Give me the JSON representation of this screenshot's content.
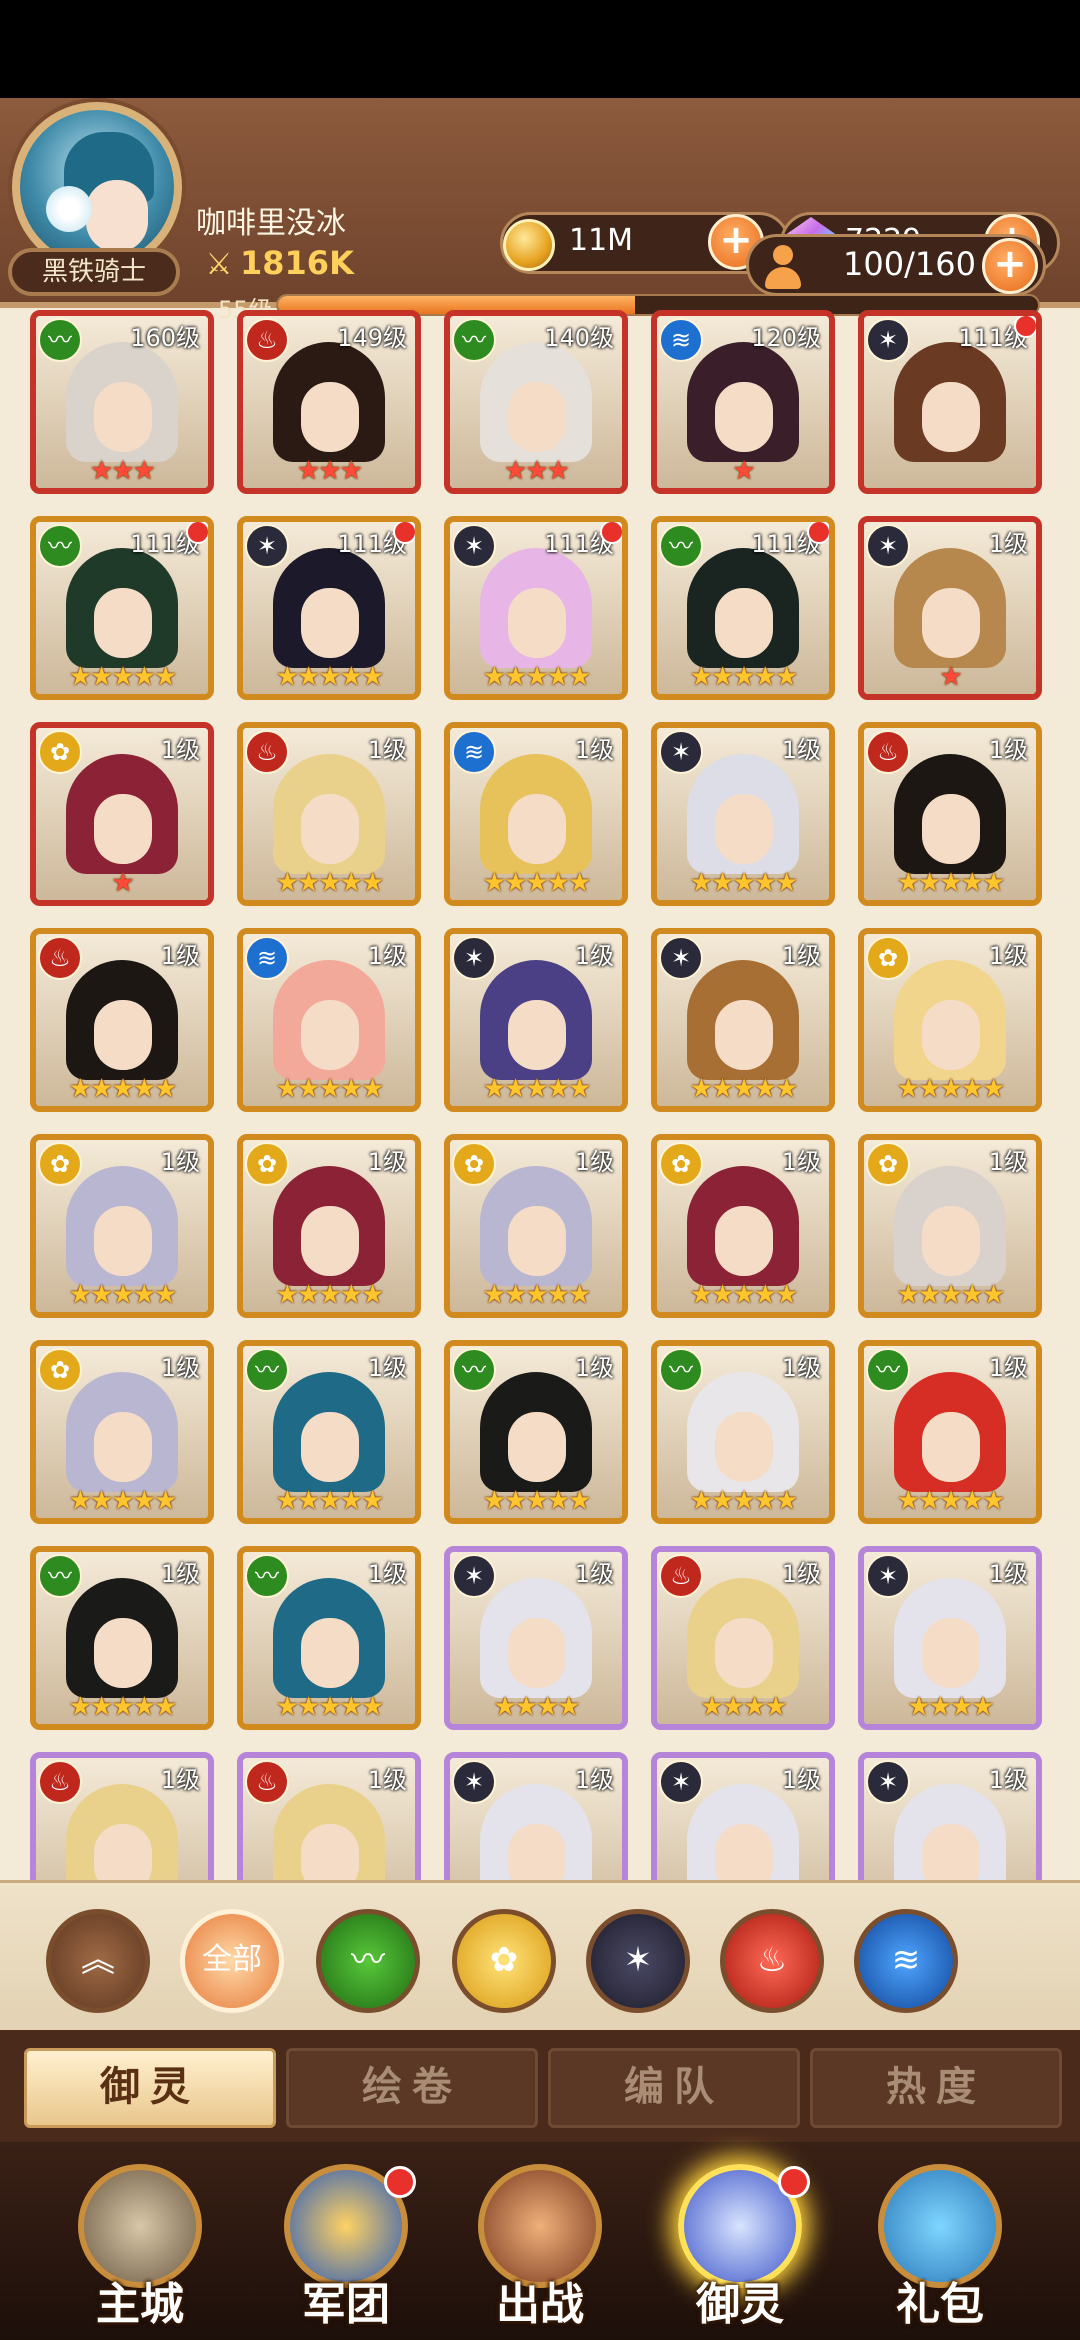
{
  "header": {
    "player_name": "咖啡里没冰",
    "power": "1816K",
    "level": "55级",
    "xp_fraction": 0.47,
    "rank_title": "黑铁骑士",
    "gold": "11M",
    "gems": "7229",
    "roster_capacity": "100/160"
  },
  "colors": {
    "nature": "#2e8b1f",
    "flame": "#c0281e",
    "water": "#1d6fd0",
    "shadow": "#2b2a3a",
    "light": "#e3a91a"
  },
  "cards": [
    {
      "level": "160级",
      "faction": "nature",
      "stars": "★★★",
      "star_color": "red",
      "frame": "red",
      "notif": false,
      "hair": "#d9d3cc"
    },
    {
      "level": "149级",
      "faction": "flame",
      "stars": "★★★",
      "star_color": "red",
      "frame": "red",
      "notif": false,
      "hair": "#2b1a14"
    },
    {
      "level": "140级",
      "faction": "nature",
      "stars": "★★★",
      "star_color": "red",
      "frame": "red",
      "notif": false,
      "hair": "#e6e0da"
    },
    {
      "level": "120级",
      "faction": "water",
      "stars": "★",
      "star_color": "red",
      "frame": "red",
      "notif": false,
      "hair": "#3a1f2a"
    },
    {
      "level": "111级",
      "faction": "shadow",
      "stars": "",
      "star_color": "red",
      "frame": "red",
      "notif": true,
      "hair": "#6a3a22"
    },
    {
      "level": "111级",
      "faction": "nature",
      "stars": "★★★★★",
      "star_color": "gold",
      "frame": "gold",
      "notif": true,
      "hair": "#203a2a"
    },
    {
      "level": "111级",
      "faction": "shadow",
      "stars": "★★★★★",
      "star_color": "gold",
      "frame": "gold",
      "notif": true,
      "hair": "#1c1a2a"
    },
    {
      "level": "111级",
      "faction": "shadow",
      "stars": "★★★★★",
      "star_color": "gold",
      "frame": "gold",
      "notif": true,
      "hair": "#e7b6e6"
    },
    {
      "level": "111级",
      "faction": "nature",
      "stars": "★★★★★",
      "star_color": "gold",
      "frame": "gold",
      "notif": true,
      "hair": "#1a2420"
    },
    {
      "level": "1级",
      "faction": "shadow",
      "stars": "★",
      "star_color": "red",
      "frame": "red",
      "notif": false,
      "hair": "#b7884d"
    },
    {
      "level": "1级",
      "faction": "light",
      "stars": "★",
      "star_color": "red",
      "frame": "red",
      "notif": false,
      "hair": "#8c2236"
    },
    {
      "level": "1级",
      "faction": "flame",
      "stars": "★★★★★",
      "star_color": "gold",
      "frame": "gold",
      "notif": false,
      "hair": "#e9d18c"
    },
    {
      "level": "1级",
      "faction": "water",
      "stars": "★★★★★",
      "star_color": "gold",
      "frame": "gold",
      "notif": false,
      "hair": "#e7c15a"
    },
    {
      "level": "1级",
      "faction": "shadow",
      "stars": "★★★★★",
      "star_color": "gold",
      "frame": "gold",
      "notif": false,
      "hair": "#dcdde6"
    },
    {
      "level": "1级",
      "faction": "flame",
      "stars": "★★★★★",
      "star_color": "gold",
      "frame": "gold",
      "notif": false,
      "hair": "#1d1714"
    },
    {
      "level": "1级",
      "faction": "flame",
      "stars": "★★★★★",
      "star_color": "gold",
      "frame": "gold",
      "notif": false,
      "hair": "#1d1714"
    },
    {
      "level": "1级",
      "faction": "water",
      "stars": "★★★★★",
      "star_color": "gold",
      "frame": "gold",
      "notif": false,
      "hair": "#f2a99a"
    },
    {
      "level": "1级",
      "faction": "shadow",
      "stars": "★★★★★",
      "star_color": "gold",
      "frame": "gold",
      "notif": false,
      "hair": "#4b3f86"
    },
    {
      "level": "1级",
      "faction": "shadow",
      "stars": "★★★★★",
      "star_color": "gold",
      "frame": "gold",
      "notif": false,
      "hair": "#a86f34"
    },
    {
      "level": "1级",
      "faction": "light",
      "stars": "★★★★★",
      "star_color": "gold",
      "frame": "gold",
      "notif": false,
      "hair": "#f1d58c"
    },
    {
      "level": "1级",
      "faction": "light",
      "stars": "★★★★★",
      "star_color": "gold",
      "frame": "gold",
      "notif": false,
      "hair": "#b9b6d2"
    },
    {
      "level": "1级",
      "faction": "light",
      "stars": "★★★★★",
      "star_color": "gold",
      "frame": "gold",
      "notif": false,
      "hair": "#8c2236"
    },
    {
      "level": "1级",
      "faction": "light",
      "stars": "★★★★★",
      "star_color": "gold",
      "frame": "gold",
      "notif": false,
      "hair": "#b9b6d2"
    },
    {
      "level": "1级",
      "faction": "light",
      "stars": "★★★★★",
      "star_color": "gold",
      "frame": "gold",
      "notif": false,
      "hair": "#8c2236"
    },
    {
      "level": "1级",
      "faction": "light",
      "stars": "★★★★★",
      "star_color": "gold",
      "frame": "gold",
      "notif": false,
      "hair": "#d9d2cc"
    },
    {
      "level": "1级",
      "faction": "light",
      "stars": "★★★★★",
      "star_color": "gold",
      "frame": "gold",
      "notif": false,
      "hair": "#b9b6d2"
    },
    {
      "level": "1级",
      "faction": "nature",
      "stars": "★★★★★",
      "star_color": "gold",
      "frame": "gold",
      "notif": false,
      "hair": "#1f6b87"
    },
    {
      "level": "1级",
      "faction": "nature",
      "stars": "★★★★★",
      "star_color": "gold",
      "frame": "gold",
      "notif": false,
      "hair": "#1a1a18"
    },
    {
      "level": "1级",
      "faction": "nature",
      "stars": "★★★★★",
      "star_color": "gold",
      "frame": "gold",
      "notif": false,
      "hair": "#e8e6e8"
    },
    {
      "level": "1级",
      "faction": "nature",
      "stars": "★★★★★",
      "star_color": "gold",
      "frame": "gold",
      "notif": false,
      "hair": "#d62e24"
    },
    {
      "level": "1级",
      "faction": "nature",
      "stars": "★★★★★",
      "star_color": "gold",
      "frame": "gold",
      "notif": false,
      "hair": "#1a1a18"
    },
    {
      "level": "1级",
      "faction": "nature",
      "stars": "★★★★★",
      "star_color": "gold",
      "frame": "gold",
      "notif": false,
      "hair": "#1f6b87"
    },
    {
      "level": "1级",
      "faction": "shadow",
      "stars": "★★★★",
      "star_color": "gold",
      "frame": "purple",
      "notif": false,
      "hair": "#e4e2ea"
    },
    {
      "level": "1级",
      "faction": "flame",
      "stars": "★★★★",
      "star_color": "gold",
      "frame": "purple",
      "notif": false,
      "hair": "#e9d18c"
    },
    {
      "level": "1级",
      "faction": "shadow",
      "stars": "★★★★",
      "star_color": "gold",
      "frame": "purple",
      "notif": false,
      "hair": "#e4e2ea"
    },
    {
      "level": "1级",
      "faction": "flame",
      "stars": "",
      "star_color": "gold",
      "frame": "purple",
      "notif": false,
      "hair": "#e9d18c"
    },
    {
      "level": "1级",
      "faction": "flame",
      "stars": "",
      "star_color": "gold",
      "frame": "purple",
      "notif": false,
      "hair": "#e9d18c"
    },
    {
      "level": "1级",
      "faction": "shadow",
      "stars": "",
      "star_color": "gold",
      "frame": "purple",
      "notif": false,
      "hair": "#e4e2ea"
    },
    {
      "level": "1级",
      "faction": "shadow",
      "stars": "",
      "star_color": "gold",
      "frame": "purple",
      "notif": false,
      "hair": "#e4e2ea"
    },
    {
      "level": "1级",
      "faction": "shadow",
      "stars": "",
      "star_color": "gold",
      "frame": "purple",
      "notif": false,
      "hair": "#e4e2ea"
    }
  ],
  "filters": {
    "all_label": "全部"
  },
  "tabs": [
    "御灵",
    "绘卷",
    "编队",
    "热度"
  ],
  "nav": [
    "主城",
    "军团",
    "出战",
    "御灵",
    "礼包"
  ]
}
